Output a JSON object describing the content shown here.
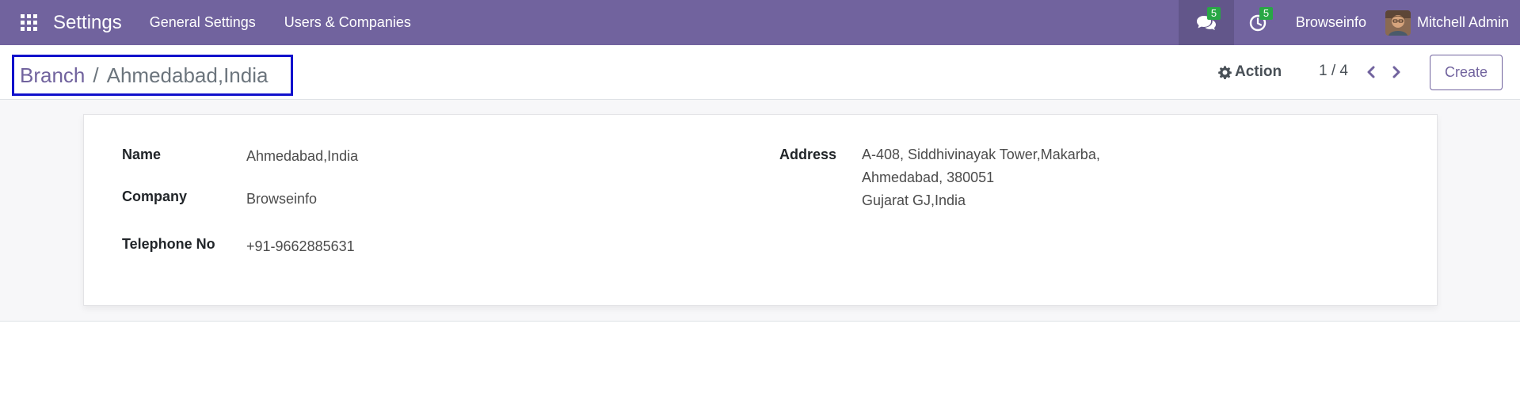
{
  "navbar": {
    "app_name": "Settings",
    "menu": [
      "General Settings",
      "Users & Companies"
    ],
    "messages_badge": "5",
    "activities_badge": "5",
    "company": "Browseinfo",
    "user_name": "Mitchell Admin",
    "bg_color": "#71639e"
  },
  "control_panel": {
    "breadcrumb_parent": "Branch",
    "breadcrumb_separator": "/",
    "breadcrumb_current": "Ahmedabad,India",
    "action_label": "Action",
    "pager_value": "1 / 4",
    "create_label": "Create"
  },
  "form": {
    "name_label": "Name",
    "name_value": "Ahmedabad,India",
    "company_label": "Company",
    "company_value": "Browseinfo",
    "phone_label": "Telephone No",
    "phone_value": "+91-9662885631",
    "address_label": "Address",
    "address_lines": [
      "A-408, Siddhivinayak Tower,Makarba,",
      "Ahmedabad, 380051",
      "Gujarat GJ,India"
    ]
  },
  "icons": {
    "apps": "apps-grid-icon",
    "messages": "comments-icon",
    "activities": "clock-icon",
    "action": "gear-icon",
    "prev": "chevron-left-icon",
    "next": "chevron-right-icon"
  }
}
